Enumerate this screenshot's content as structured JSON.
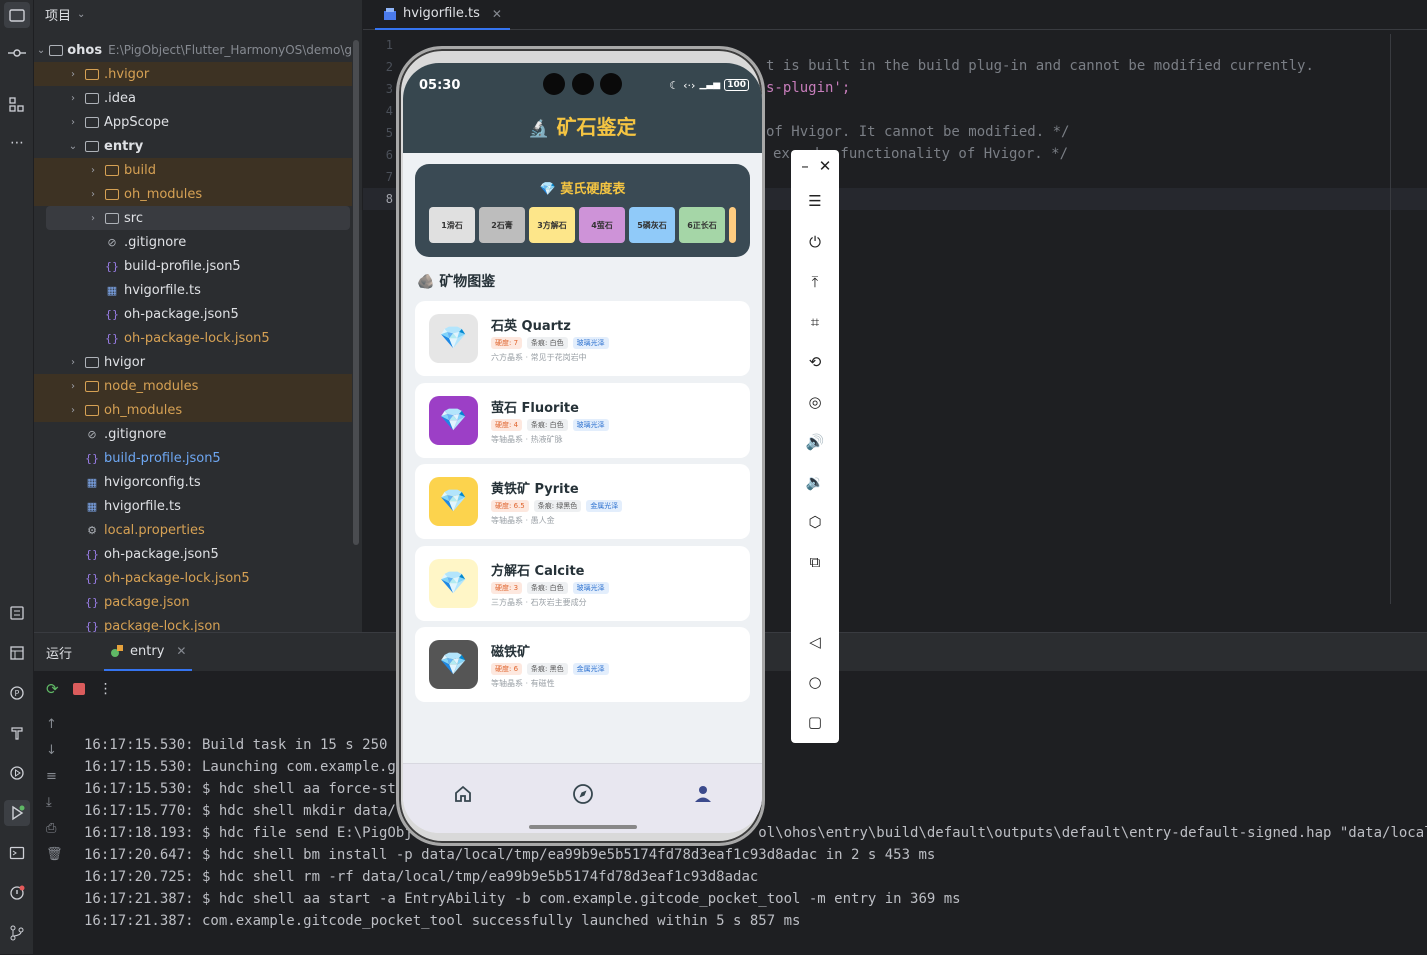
{
  "project": {
    "header": "项目",
    "tree": [
      {
        "label": "ohos",
        "path": "E:\\PigObject\\Flutter_HarmonyOS\\demo\\g",
        "type": "folder",
        "depth": 0,
        "expanded": true,
        "style": "root"
      },
      {
        "label": ".hvigor",
        "type": "folder",
        "depth": 1,
        "expanded": false,
        "style": "orange-excluded"
      },
      {
        "label": ".idea",
        "type": "folder",
        "depth": 1,
        "expanded": false,
        "style": "normal"
      },
      {
        "label": "AppScope",
        "type": "folder",
        "depth": 1,
        "expanded": false,
        "style": "normal"
      },
      {
        "label": "entry",
        "type": "folder",
        "depth": 1,
        "expanded": true,
        "style": "bold"
      },
      {
        "label": "build",
        "type": "folder",
        "depth": 2,
        "expanded": false,
        "style": "orange-excluded"
      },
      {
        "label": "oh_modules",
        "type": "folder",
        "depth": 2,
        "expanded": false,
        "style": "orange-excluded"
      },
      {
        "label": "src",
        "type": "folder",
        "depth": 2,
        "expanded": false,
        "style": "selected"
      },
      {
        "label": ".gitignore",
        "type": "ignore",
        "depth": 2,
        "style": "normal"
      },
      {
        "label": "build-profile.json5",
        "type": "json",
        "depth": 2,
        "style": "normal"
      },
      {
        "label": "hvigorfile.ts",
        "type": "ts",
        "depth": 2,
        "style": "normal"
      },
      {
        "label": "oh-package.json5",
        "type": "json",
        "depth": 2,
        "style": "normal"
      },
      {
        "label": "oh-package-lock.json5",
        "type": "json",
        "depth": 2,
        "style": "orange"
      },
      {
        "label": "hvigor",
        "type": "folder",
        "depth": 1,
        "expanded": false,
        "style": "normal"
      },
      {
        "label": "node_modules",
        "type": "folder",
        "depth": 1,
        "expanded": false,
        "style": "orange-excluded"
      },
      {
        "label": "oh_modules",
        "type": "folder",
        "depth": 1,
        "expanded": false,
        "style": "orange-excluded"
      },
      {
        "label": ".gitignore",
        "type": "ignore",
        "depth": 1,
        "style": "normal"
      },
      {
        "label": "build-profile.json5",
        "type": "json",
        "depth": 1,
        "style": "blue"
      },
      {
        "label": "hvigorconfig.ts",
        "type": "ts",
        "depth": 1,
        "style": "normal"
      },
      {
        "label": "hvigorfile.ts",
        "type": "ts",
        "depth": 1,
        "style": "normal"
      },
      {
        "label": "local.properties",
        "type": "props",
        "depth": 1,
        "style": "orange"
      },
      {
        "label": "oh-package.json5",
        "type": "json",
        "depth": 1,
        "style": "normal"
      },
      {
        "label": "oh-package-lock.json5",
        "type": "json",
        "depth": 1,
        "style": "orange"
      },
      {
        "label": "package.json",
        "type": "json",
        "depth": 1,
        "style": "orange"
      },
      {
        "label": "package-lock.json",
        "type": "json",
        "depth": 1,
        "style": "orange"
      }
    ]
  },
  "editor": {
    "tab": "hvigorfile.ts",
    "line_numbers": [
      "1",
      "2",
      "3",
      "4",
      "5",
      "6",
      "7",
      "8"
    ],
    "visible_code": [
      {
        "line": 2,
        "text": "t is built in the build plug-in and cannot be modified currently.",
        "kind": "comment"
      },
      {
        "line": 3,
        "text": "s-plugin';",
        "kind": "string"
      },
      {
        "line": 5,
        "text": "of Hvigor. It cannot be modified. */",
        "kind": "comment"
      },
      {
        "line": 6,
        "text": "ex   he functionality of Hvigor. */",
        "kind": "comment"
      }
    ]
  },
  "run": {
    "title": "运行",
    "tab": "entry",
    "log": [
      "16:17:15.530: Build task in 15 s 250 ms",
      "16:17:15.530: Launching com.example.git",
      "16:17:15.530: $ hdc shell aa force-stop",
      "16:17:15.770: $ hdc shell mkdir data/lo",
      "16:17:18.193: $ hdc file send E:\\PigObje                                        ol\\ohos\\entry\\build\\default\\outputs\\default\\entry-default-signed.hap \"data/local/tmp/",
      "16:17:20.647: $ hdc shell bm install -p data/local/tmp/ea99b9e5b5174fd78d3eaf1c93d8adac in 2 s 453 ms",
      "16:17:20.725: $ hdc shell rm -rf data/local/tmp/ea99b9e5b5174fd78d3eaf1c93d8adac",
      "16:17:21.387: $ hdc shell aa start -a EntryAbility -b com.example.gitcode_pocket_tool -m entry in 369 ms",
      "16:17:21.387: com.example.gitcode_pocket_tool successfully launched within 5 s 857 ms"
    ]
  },
  "phone": {
    "time": "05:30",
    "battery": "100",
    "app_title": "矿石鉴定",
    "mohs_title": "莫氏硬度表",
    "mohs_scale": [
      {
        "label": "1滑石",
        "color": "#e0e0e0"
      },
      {
        "label": "2石膏",
        "color": "#bdbdbd"
      },
      {
        "label": "3方解石",
        "color": "#fde68a"
      },
      {
        "label": "4萤石",
        "color": "#ce93d8"
      },
      {
        "label": "5磷灰石",
        "color": "#90caf9"
      },
      {
        "label": "6正长石",
        "color": "#a5d6a7"
      },
      {
        "label": "",
        "color": "#ffcc80"
      }
    ],
    "section_title": "矿物图鉴",
    "minerals": [
      {
        "name": "石英 Quartz",
        "hardness": "硬度: 7",
        "streak": "条痕: 白色",
        "luster": "玻璃光泽",
        "desc": "六方晶系 · 常见于花岗岩中",
        "bg": "#e6e6e6"
      },
      {
        "name": "萤石 Fluorite",
        "hardness": "硬度: 4",
        "streak": "条痕: 白色",
        "luster": "玻璃光泽",
        "desc": "等轴晶系 · 热液矿脉",
        "bg": "#9c3fc6"
      },
      {
        "name": "黄铁矿 Pyrite",
        "hardness": "硬度: 6.5",
        "streak": "条痕: 绿黑色",
        "luster": "金属光泽",
        "desc": "等轴晶系 · 愚人金",
        "bg": "#fcd34d"
      },
      {
        "name": "方解石 Calcite",
        "hardness": "硬度: 3",
        "streak": "条痕: 白色",
        "luster": "玻璃光泽",
        "desc": "三方晶系 · 石灰岩主要成分",
        "bg": "#fff6c7"
      },
      {
        "name": "磁铁矿",
        "hardness": "硬度: 6",
        "streak": "条痕: 黑色",
        "luster": "金属光泽",
        "desc": "等轴晶系 · 有磁性",
        "bg": "#555555"
      }
    ],
    "nav": [
      "home-icon",
      "compass-icon",
      "person-icon"
    ],
    "accent": "#f5c542",
    "header_bg": "#37474f"
  },
  "emulator_toolbar": {
    "buttons": [
      "minimize",
      "close",
      "menu",
      "power",
      "top",
      "crop",
      "rotate",
      "screenshot",
      "volume-up",
      "volume-down",
      "shake",
      "screens",
      "back",
      "home",
      "recent"
    ]
  }
}
